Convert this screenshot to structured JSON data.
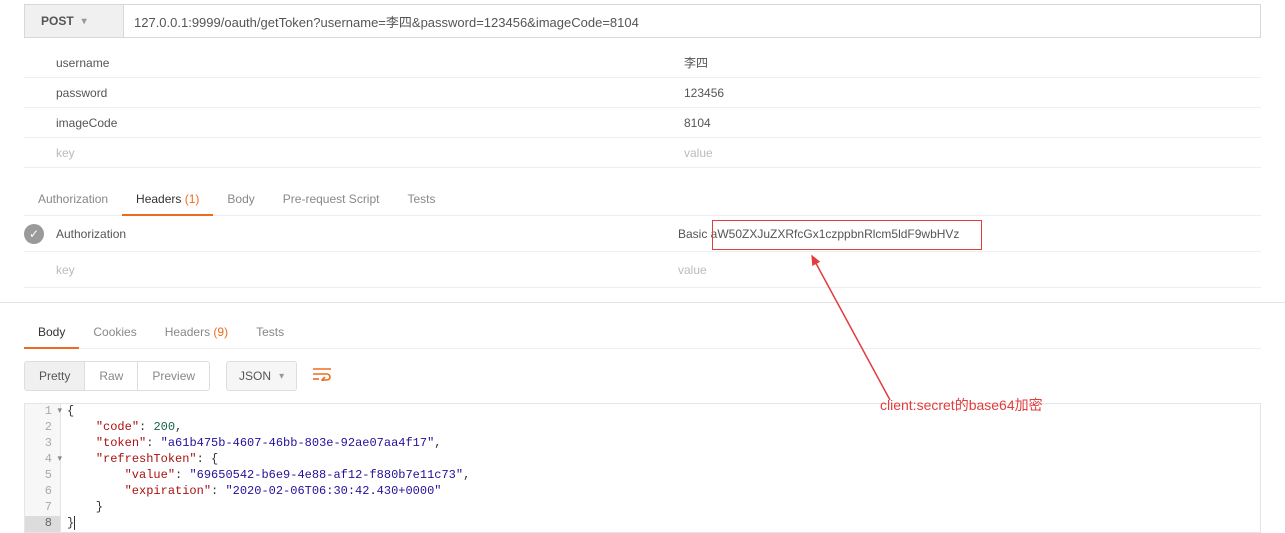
{
  "request": {
    "method": "POST",
    "url": "127.0.0.1:9999/oauth/getToken?username=李四&password=123456&imageCode=8104"
  },
  "params": [
    {
      "key": "username",
      "value": "李四"
    },
    {
      "key": "password",
      "value": "123456"
    },
    {
      "key": "imageCode",
      "value": "8104"
    }
  ],
  "param_placeholder": {
    "key": "key",
    "value": "value"
  },
  "req_tabs": {
    "auth": "Authorization",
    "headers": "Headers",
    "headers_count": "(1)",
    "body": "Body",
    "prereq": "Pre-request Script",
    "tests": "Tests"
  },
  "headers": [
    {
      "key": "Authorization",
      "value": "Basic aW50ZXJuZXRfcGx1czppbnRlcm5ldF9wbHVz"
    }
  ],
  "header_placeholder": {
    "key": "key",
    "value": "value"
  },
  "resp_tabs": {
    "body": "Body",
    "cookies": "Cookies",
    "headers": "Headers",
    "headers_count": "(9)",
    "tests": "Tests"
  },
  "toolbar": {
    "pretty": "Pretty",
    "raw": "Raw",
    "preview": "Preview",
    "format": "JSON"
  },
  "json_lines": {
    "l1": "{",
    "l2_k": "\"code\"",
    "l2_v": "200",
    "l3_k": "\"token\"",
    "l3_v": "\"a61b475b-4607-46bb-803e-92ae07aa4f17\"",
    "l4_k": "\"refreshToken\"",
    "l5_k": "\"value\"",
    "l5_v": "\"69650542-b6e9-4e88-af12-f880b7e11c73\"",
    "l6_k": "\"expiration\"",
    "l6_v": "\"2020-02-06T06:30:42.430+0000\"",
    "l7": "    }",
    "l8": "}"
  },
  "annotation": "client:secret的base64加密"
}
